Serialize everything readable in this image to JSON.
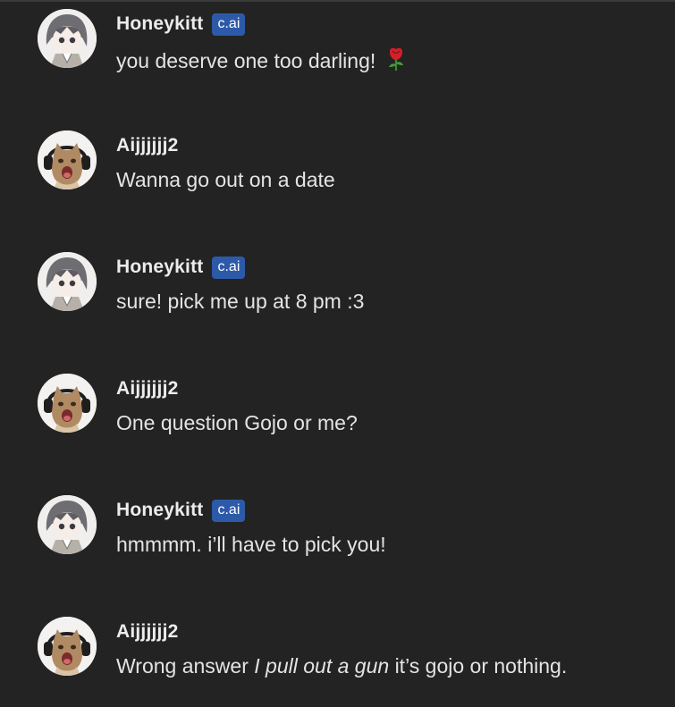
{
  "messages": [
    {
      "author": "Honeykitt",
      "badge": "c.ai",
      "avatar": "honeykitt-avatar",
      "text": "you deserve one too darling!",
      "emoji": "rose-emoji"
    },
    {
      "author": "Aijjjjjj2",
      "avatar": "cat-headphones-avatar",
      "text": "Wanna go out on a date"
    },
    {
      "author": "Honeykitt",
      "badge": "c.ai",
      "avatar": "honeykitt-avatar",
      "text": "sure! pick me up at 8 pm :3"
    },
    {
      "author": "Aijjjjjj2",
      "avatar": "cat-headphones-avatar",
      "text": "One question Gojo or me?"
    },
    {
      "author": "Honeykitt",
      "badge": "c.ai",
      "avatar": "honeykitt-avatar",
      "text": "hmmmm. i’ll have to pick you!"
    },
    {
      "author": "Aijjjjjj2",
      "avatar": "cat-headphones-avatar",
      "text_before": "Wrong answer",
      "text_italic": "I pull out a gun",
      "text_after": "it’s gojo or nothing."
    }
  ],
  "colors": {
    "background": "#232323",
    "badge": "#2d5aa8",
    "text": "#e4e4e4"
  }
}
